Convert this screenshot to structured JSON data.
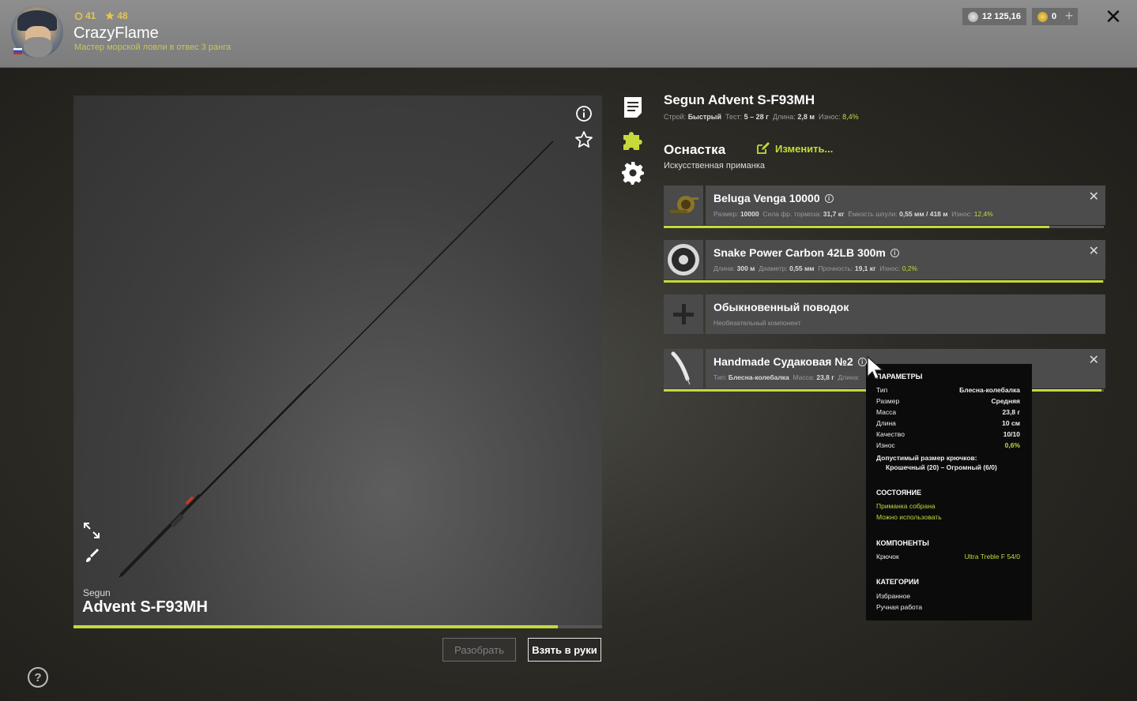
{
  "header": {
    "level_main": "41",
    "level_star": "48",
    "username": "CrazyFlame",
    "rank": "Мастер морской ловли в отвес 3 ранга",
    "silver": "12 125,16",
    "gold": "0",
    "add_label": "+",
    "close_label": "✕"
  },
  "preview": {
    "brand": "Segun",
    "model": "Advent S-F93MH",
    "wear_percent": 91.6,
    "disassemble_label": "Разобрать",
    "take_label": "Взять в руки"
  },
  "rod": {
    "title": "Segun Advent S-F93MH",
    "build_label": "Строй:",
    "build_value": "Быстрый",
    "test_label": "Тест:",
    "test_value": "5 – 28 г",
    "length_label": "Длина:",
    "length_value": "2,8 м",
    "wear_label": "Износ:",
    "wear_value": "8,4%"
  },
  "tackle": {
    "title": "Оснастка",
    "change_label": "Изменить...",
    "subtitle": "Искусственная приманка"
  },
  "slots": [
    {
      "name": "Beluga Venga 10000",
      "desc": [
        [
          "Размер:",
          "10000"
        ],
        [
          "Сила фр. тормоза:",
          "31,7 кг"
        ],
        [
          "Ёмкость шпули:",
          "0,55 мм / 418 м"
        ],
        [
          "Износ:",
          "12,4%"
        ]
      ],
      "wear_percent": 87.6
    },
    {
      "name": "Snake Power Carbon 42LB 300m",
      "desc": [
        [
          "Длина:",
          "300 м"
        ],
        [
          "Диаметр:",
          "0,55 мм"
        ],
        [
          "Прочность:",
          "19,1 кг"
        ],
        [
          "Износ:",
          "0,2%"
        ]
      ],
      "wear_percent": 99.8
    },
    {
      "name": "Обыкновенный поводок",
      "desc_text": "Необязательный компонент"
    },
    {
      "name": "Handmade Судаковая №2",
      "desc": [
        [
          "Тип:",
          "Блесна-колебалка"
        ],
        [
          "Масса:",
          "23,8 г"
        ],
        [
          "Длина:",
          ""
        ]
      ],
      "wear_percent": 99.4
    }
  ],
  "tooltip": {
    "params_title": "ПАРАМЕТРЫ",
    "params": [
      [
        "Тип",
        "Блесна-колебалка"
      ],
      [
        "Размер",
        "Средняя"
      ],
      [
        "Масса",
        "23,8 г"
      ],
      [
        "Длина",
        "10 см"
      ],
      [
        "Качество",
        "10/10"
      ],
      [
        "Износ",
        "0,6%"
      ]
    ],
    "hook_size_label": "Допустимый размер крючков:",
    "hook_size_value": "Крошечный (20) – Огромный (6/0)",
    "state_title": "СОСТОЯНИЕ",
    "state_1": "Приманка собрана",
    "state_2": "Можно использовать",
    "components_title": "КОМПОНЕНТЫ",
    "component_label": "Крючок",
    "component_value": "Ultra Treble F 54/0",
    "categories_title": "КАТЕГОРИИ",
    "category_1": "Избранное",
    "category_2": "Ручная работа"
  },
  "colors": {
    "accent": "#c5d93a",
    "header_bg": "#8a8a8a",
    "gold_text": "#e5c64d"
  }
}
